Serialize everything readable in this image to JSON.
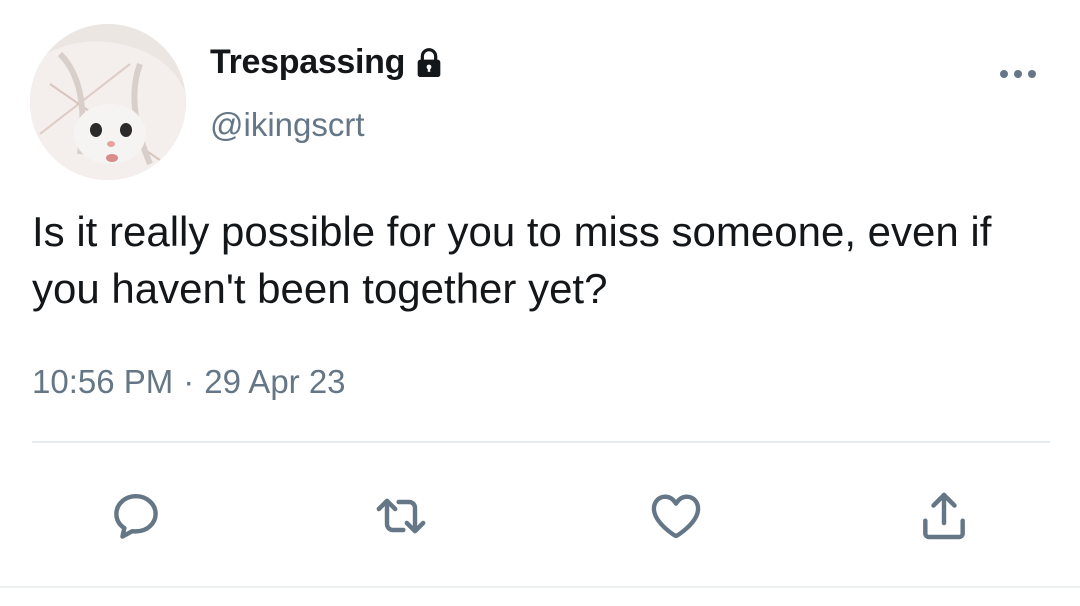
{
  "tweet": {
    "display_name": "Trespassing",
    "protected_icon": "lock-icon",
    "handle": "@ikingscrt",
    "text": "Is it really possible for you to miss someone, even if you haven't been together yet?",
    "time": "10:56 PM",
    "separator": "·",
    "date": "29 Apr 23"
  },
  "actions": {
    "reply_icon": "reply-icon",
    "retweet_icon": "retweet-icon",
    "like_icon": "heart-icon",
    "share_icon": "share-icon"
  },
  "menu_icon": "more-icon",
  "colors": {
    "text_primary": "#14171a",
    "text_secondary": "#657786",
    "icon": "#657786",
    "divider": "#e6ecf0"
  }
}
